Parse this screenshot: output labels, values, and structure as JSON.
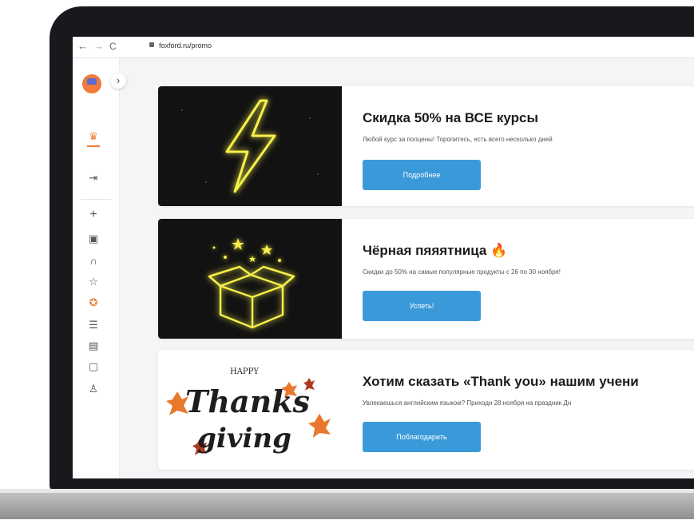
{
  "browser": {
    "back": "←",
    "forward": "→",
    "reload": "C",
    "url": "foxford.ru/promo"
  },
  "sidebar": {
    "expand_chevron": "›",
    "icons": [
      {
        "name": "graduation-cap-icon",
        "glyph": "♛"
      },
      {
        "name": "login-icon",
        "glyph": "⇥"
      },
      {
        "name": "plus-icon",
        "glyph": "+"
      },
      {
        "name": "calendar-icon",
        "glyph": "▣"
      },
      {
        "name": "headphones-icon",
        "glyph": "∩"
      },
      {
        "name": "star-icon",
        "glyph": "☆"
      },
      {
        "name": "promo-icon",
        "glyph": "✪"
      },
      {
        "name": "list-icon",
        "glyph": "☰"
      },
      {
        "name": "book-icon",
        "glyph": "▤"
      },
      {
        "name": "chat-icon",
        "glyph": "▢"
      },
      {
        "name": "trophy-icon",
        "glyph": "♙"
      }
    ]
  },
  "promos": [
    {
      "title": "Скидка 50% на ВСЕ курсы",
      "description": "Любой курс за полцены! Торопитесь, есть всего несколько дней",
      "button": "Подробнее",
      "image": "lightning-neon"
    },
    {
      "title": "Чёрная пяяятница 🔥",
      "description": "Скидки до 50% на самые популярные продукты с 26 по 30 ноября!",
      "button": "Успеть!",
      "image": "gift-box-neon"
    },
    {
      "title": "Хотим сказать «Thank you» нашим учени",
      "description": "Увлекаешься английским языком? Приходи 28 ноября на праздник Дн",
      "button": "Поблагодарить",
      "image": "thanksgiving-lettering",
      "image_text_small": "HAPPY",
      "image_text_1": "Thanks",
      "image_text_2": "giving"
    }
  ],
  "colors": {
    "accent": "#f07b3a",
    "button": "#3a9ad9",
    "neon": "#f6f04a"
  }
}
